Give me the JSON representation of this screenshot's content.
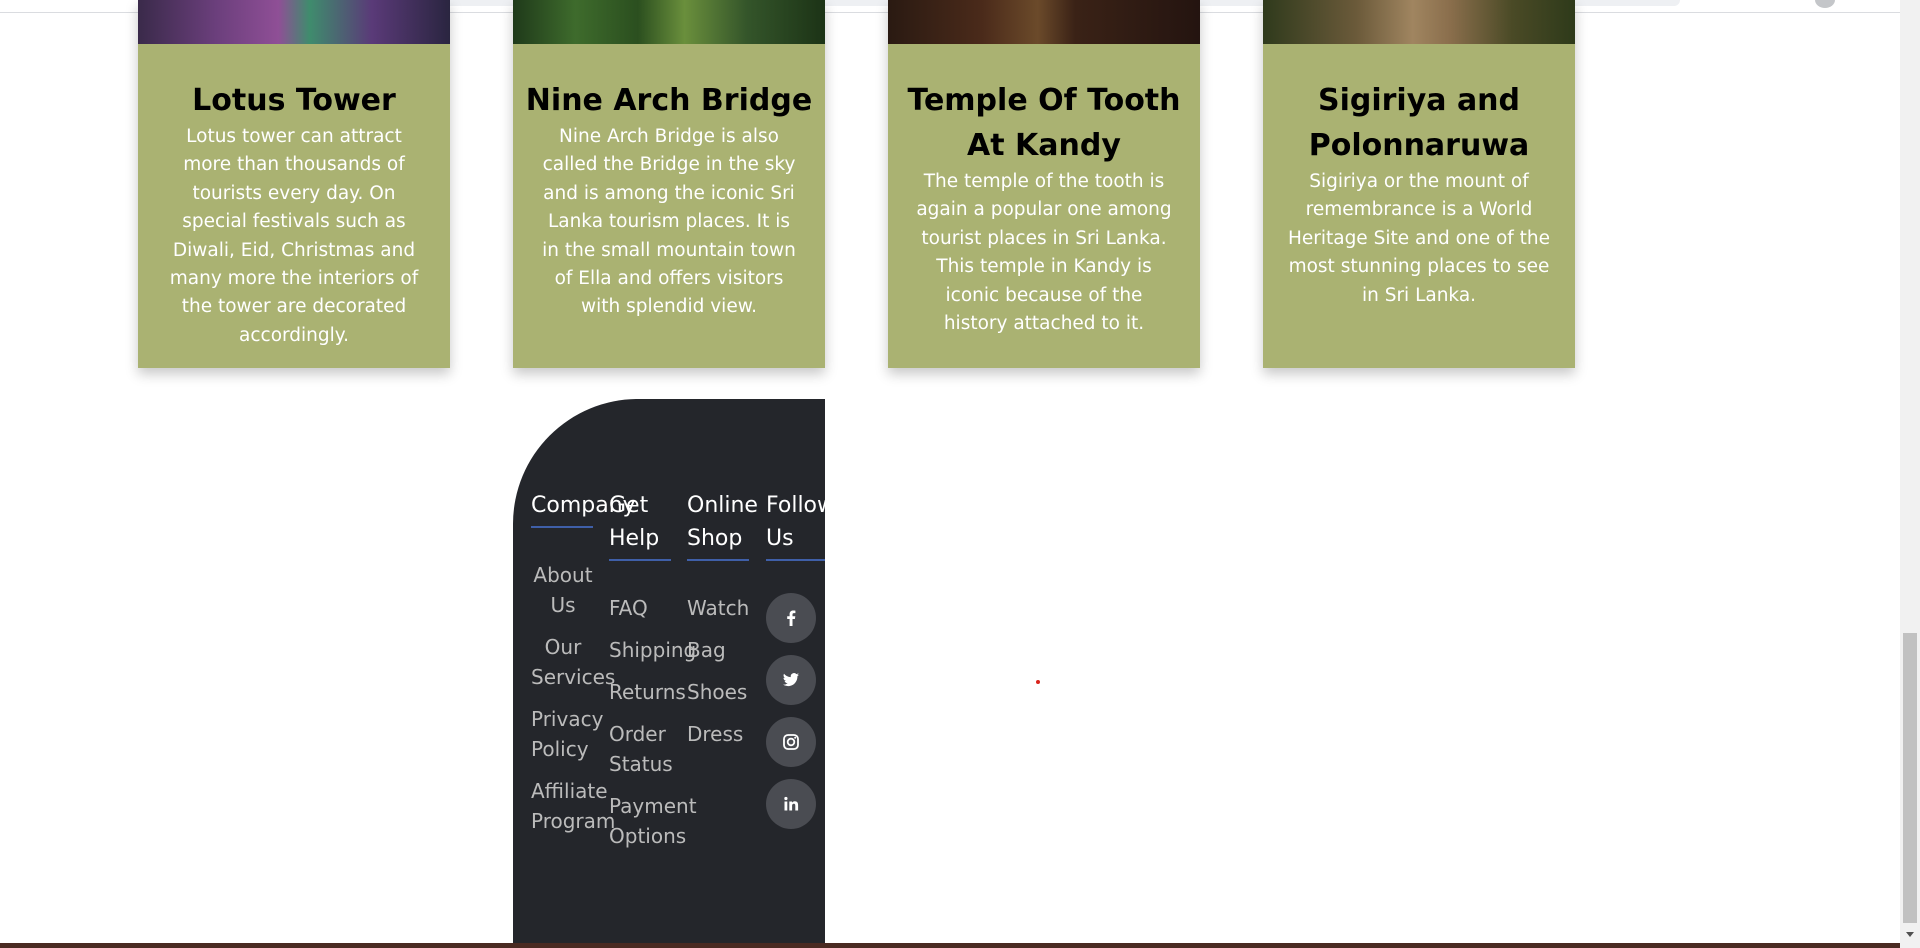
{
  "cards": [
    {
      "title": "Lotus Tower",
      "desc": "Lotus tower can attract more than thousands of tourists every day. On special festivals such as Diwali, Eid, Christmas and many more the interiors of the tower are decorated accordingly."
    },
    {
      "title": "Nine Arch Bridge",
      "desc": "Nine Arch Bridge is also called the Bridge in the sky and is among the iconic Sri Lanka tourism places. It is in the small mountain town of Ella and offers visitors with splendid view."
    },
    {
      "title": "Temple Of Tooth At Kandy",
      "desc": "The temple of the tooth is again a popular one among tourist places in Sri Lanka. This temple in Kandy is iconic because of the history attached to it."
    },
    {
      "title": "Sigiriya and Polonnaruwa",
      "desc": "Sigiriya or the mount of remembrance is a World Heritage Site and one of the most stunning places to see in Sri Lanka."
    }
  ],
  "footer": {
    "company": {
      "heading": "Company",
      "links": [
        "About Us",
        "Our Services",
        "Privacy Policy",
        "Affiliate Program"
      ]
    },
    "help": {
      "heading": "Get\nHelp",
      "links": [
        "FAQ",
        "Shipping",
        "Returns",
        "Order Status",
        "Payment Options"
      ]
    },
    "shop": {
      "heading": "Online\nShop",
      "links": [
        "Watch",
        "Bag",
        "Shoes",
        "Dress"
      ]
    },
    "follow": {
      "heading": "Follow\nUs",
      "icons": [
        "facebook-icon",
        "twitter-icon",
        "instagram-icon",
        "linkedin-icon"
      ]
    }
  },
  "colors": {
    "card_bg": "#aab272",
    "footer_bg": "#24262b",
    "accent_rule": "#3f5fa8"
  }
}
